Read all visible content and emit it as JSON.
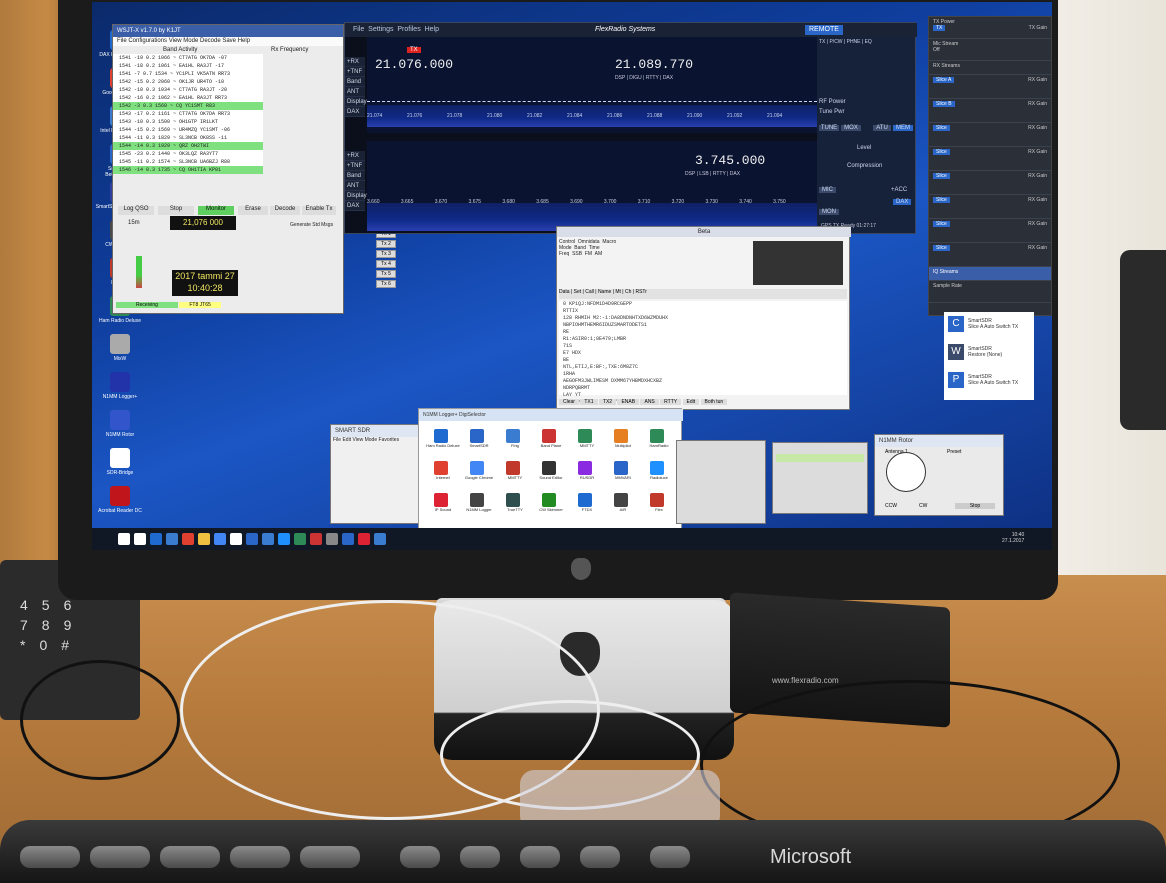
{
  "flexradio": {
    "menu": [
      "File",
      "Settings",
      "Profiles",
      "Help"
    ],
    "title": "FlexRadio Systems",
    "remote": "REMOTE",
    "slice_a_freq": "21.076.000",
    "slice_a_tx": "TX",
    "slice_a_rx_freq": "21.089.770",
    "slice_b_freq": "3.745.000",
    "modes": [
      "DSP",
      "DIGU",
      "RTTY",
      "DAX"
    ],
    "modes_b": [
      "DSP",
      "LSB",
      "RTTY",
      "DAX"
    ],
    "side_buttons": [
      "+RX",
      "+TNF",
      "Band",
      "ANT",
      "Display",
      "DAX"
    ],
    "scale_a": [
      "21.074",
      "21.076",
      "21.078",
      "21.080",
      "21.082",
      "21.084",
      "21.086",
      "21.088",
      "21.090",
      "21.092",
      "21.094"
    ],
    "scale_b": [
      "3.660",
      "3.665",
      "3.670",
      "3.675",
      "3.680",
      "3.685",
      "3.690",
      "3.700",
      "3.710",
      "3.720",
      "3.730",
      "3.740",
      "3.750"
    ],
    "right_labels": [
      "RF Power",
      "Tune Pwr",
      "TUNE",
      "MOX",
      "ATU",
      "MEM",
      "Level",
      "Compression",
      "MIC",
      "+ACC",
      "DAX",
      "MON"
    ],
    "tabs": [
      "TX",
      "P/CW",
      "PHNE",
      "EQ"
    ],
    "status": [
      "GPS",
      "TX",
      "Ready"
    ],
    "time": "01:27:17"
  },
  "wsjt": {
    "title": "WSJT-X v1.7.0 by K1JT",
    "menu": [
      "File",
      "Configurations",
      "View",
      "Mode",
      "Decode",
      "Save",
      "Help"
    ],
    "band_activity": "Band Activity",
    "rx_frequency": "Rx Frequency",
    "lines": [
      "1541 -19 0.2 1066 ~ CT7ATG OK7DA -07",
      "1541 -18 0.2 1061 ~ EA1HL RA3JT -17",
      "1541 -7 0.7 1534 ~ YC1PLI VK5ATN RR73",
      "1542 -15 0.2 2060 ~ OK1JR UR4TO -10",
      "1542 -10 0.3 1034 ~ CT7ATG RA3JT -20",
      "1542 -16 0.2 1062 ~ EA1HL RA3JT RR73",
      "1542 -3 0.3 1560 ~ CQ YC1SMT R83",
      "1543 -17 0.2 1161 ~ CT7ATG OK7DA RR73",
      "1543 -10 0.3 1500 ~ OH1GTP IR1LKT",
      "1544 -15 0.2 1569 ~ UR4MZQ YC1SMT -06",
      "1544 -11 0.3 1829 ~ SL3NCB OK8SS -11",
      "1544 -14 0.3 1929 ~ QRZ OH2TWI",
      "1545 -23 0.2 1440 ~ OK3LQZ RA3YT7",
      "1545 -11 0.2 1574 ~ SL3NCB UA6BZJ R88",
      "1546 -14 0.3 1735 ~ CQ OH1TIA KP01"
    ],
    "green_rows": [
      6,
      11,
      14
    ],
    "buttons": [
      "Log QSO",
      "Stop",
      "Monitor",
      "Erase",
      "Decode",
      "Enable Tx",
      "Halt Tx",
      "Tune"
    ],
    "freq_display": "21,076 000",
    "band": "15m",
    "clock_line1": "2017 tammi 27",
    "clock_line2": "10:40:28",
    "footer": [
      "Receiving",
      "FT8 JT65"
    ],
    "tx_labels": [
      "Tx 1",
      "Tx 2",
      "Tx 3",
      "Tx 4",
      "Tx 5",
      "Tx 6"
    ],
    "generate": "Generate Std Msgs",
    "next": "Next"
  },
  "mixer": {
    "headers": [
      "TX Power",
      "Mic Stream",
      "RX Streams"
    ],
    "tx": "TX",
    "items": [
      "Slice A",
      "Slice B",
      "Slice",
      "Slice",
      "Slice",
      "Slice",
      "Slice",
      "Slice"
    ],
    "streaming": "Streaming",
    "off": "Off",
    "rx_gain": "RX Gain",
    "tx_gain": "TX Gain",
    "sample_rate": "Sample Rate",
    "iq_header": "IQ Streams"
  },
  "logger": {
    "title": "Beta",
    "fields": [
      "Control",
      "Omnidata",
      "Macro",
      "Mode",
      "Band",
      "Time",
      "Freq",
      "SSB",
      "FM",
      "AM"
    ],
    "buttons": [
      "Clear",
      "TX1",
      "TX2",
      "ENAB",
      "ANS",
      "RTTY",
      "Edit",
      "Both tun"
    ],
    "row2": [
      "Data",
      "Set",
      "Call",
      "Name",
      "Mt",
      "Ch",
      "RSTr"
    ],
    "lines": [
      "0 KP1QJ:NFDM1D4D9RCGEPP",
      "RTTIX",
      "128 RHMIH M2:-1:DA8DNDNHTXD6WZMDUHX",
      "NBPIOHMTHEMR6IDUZSMARTODETS1",
      "RE",
      "R1:ASIR0:1;0E479;LMBR",
      "71S",
      "E7 HDX",
      "BE",
      "NTL,ETIJ,E:BF:,TXE:6M8Z7C",
      "1RHA",
      "AEGOFM3JWLIMESM DXMM67YHBMDXHCXBZ",
      "NDRPQBRMT",
      "LAY YT",
      "KE:BE/YL;LG;7LKP1715:E"
    ]
  },
  "desktop_icons": [
    "DAX Beta_v1.10.1",
    "Google Chrome",
    "Intel HD Graphics",
    "SmartSDR Beta_v1.10.1",
    "SmartSDR CAT v1.10",
    "CW Skimmer",
    "MMTTY",
    "Ham Radio Deluxe",
    "MixW",
    "N1MM Logger+",
    "N1MM Rotor",
    "SDR-Bridge",
    "Acrobat Reader DC"
  ],
  "icon_win": {
    "title": "N1MM Logger+ DigiSelector",
    "icons": [
      "Ham Radio Deluxe",
      "SmartSDR",
      "Flrig",
      "Band Plane",
      "MMTTY",
      "Multipilot",
      "HamRadio",
      "Internet",
      "Google Chrome",
      "MMTTY",
      "Sound Editor",
      "RUSDR",
      "MMVARI",
      "Radioluce",
      "IP Sound",
      "N1MM Logger",
      "TrueTTY",
      "CW Skimmer",
      "FTDX",
      "AIR",
      "Flex"
    ]
  },
  "smartsdr_cmds": [
    {
      "letter": "C",
      "line1": "SmartSDR",
      "line2": "Slice A Auto Switch TX"
    },
    {
      "letter": "W",
      "line1": "SmartSDR",
      "line2": "Restore (None)"
    },
    {
      "letter": "P",
      "line1": "SmartSDR",
      "line2": "Slice A Auto Switch TX"
    }
  ],
  "rotor": {
    "title": "N1MM Rotor",
    "azimuth": "Antenna 1",
    "preset": "Preset",
    "stop": "Stop",
    "ccw": "CCW",
    "cw": "CW"
  },
  "hrd_small": {
    "title": "SMART SDR",
    "menu": [
      "File",
      "Edit",
      "View",
      "Mode",
      "Favorites"
    ]
  },
  "system_clock": {
    "time": "10:40",
    "date": "27.1.2017"
  },
  "keyboard_brand": "Microsoft",
  "flex_box_label": "www.flexradio.com",
  "colors": {
    "flex_bg": "#0b0f1c",
    "spectrum": "#1b3fa8",
    "tx_red": "#d22",
    "green": "#7fe07f",
    "screen_blue": "#1b56c4"
  },
  "phone_keys": [
    "4",
    "5",
    "6",
    "7",
    "8",
    "9",
    "*",
    "0",
    "#"
  ]
}
